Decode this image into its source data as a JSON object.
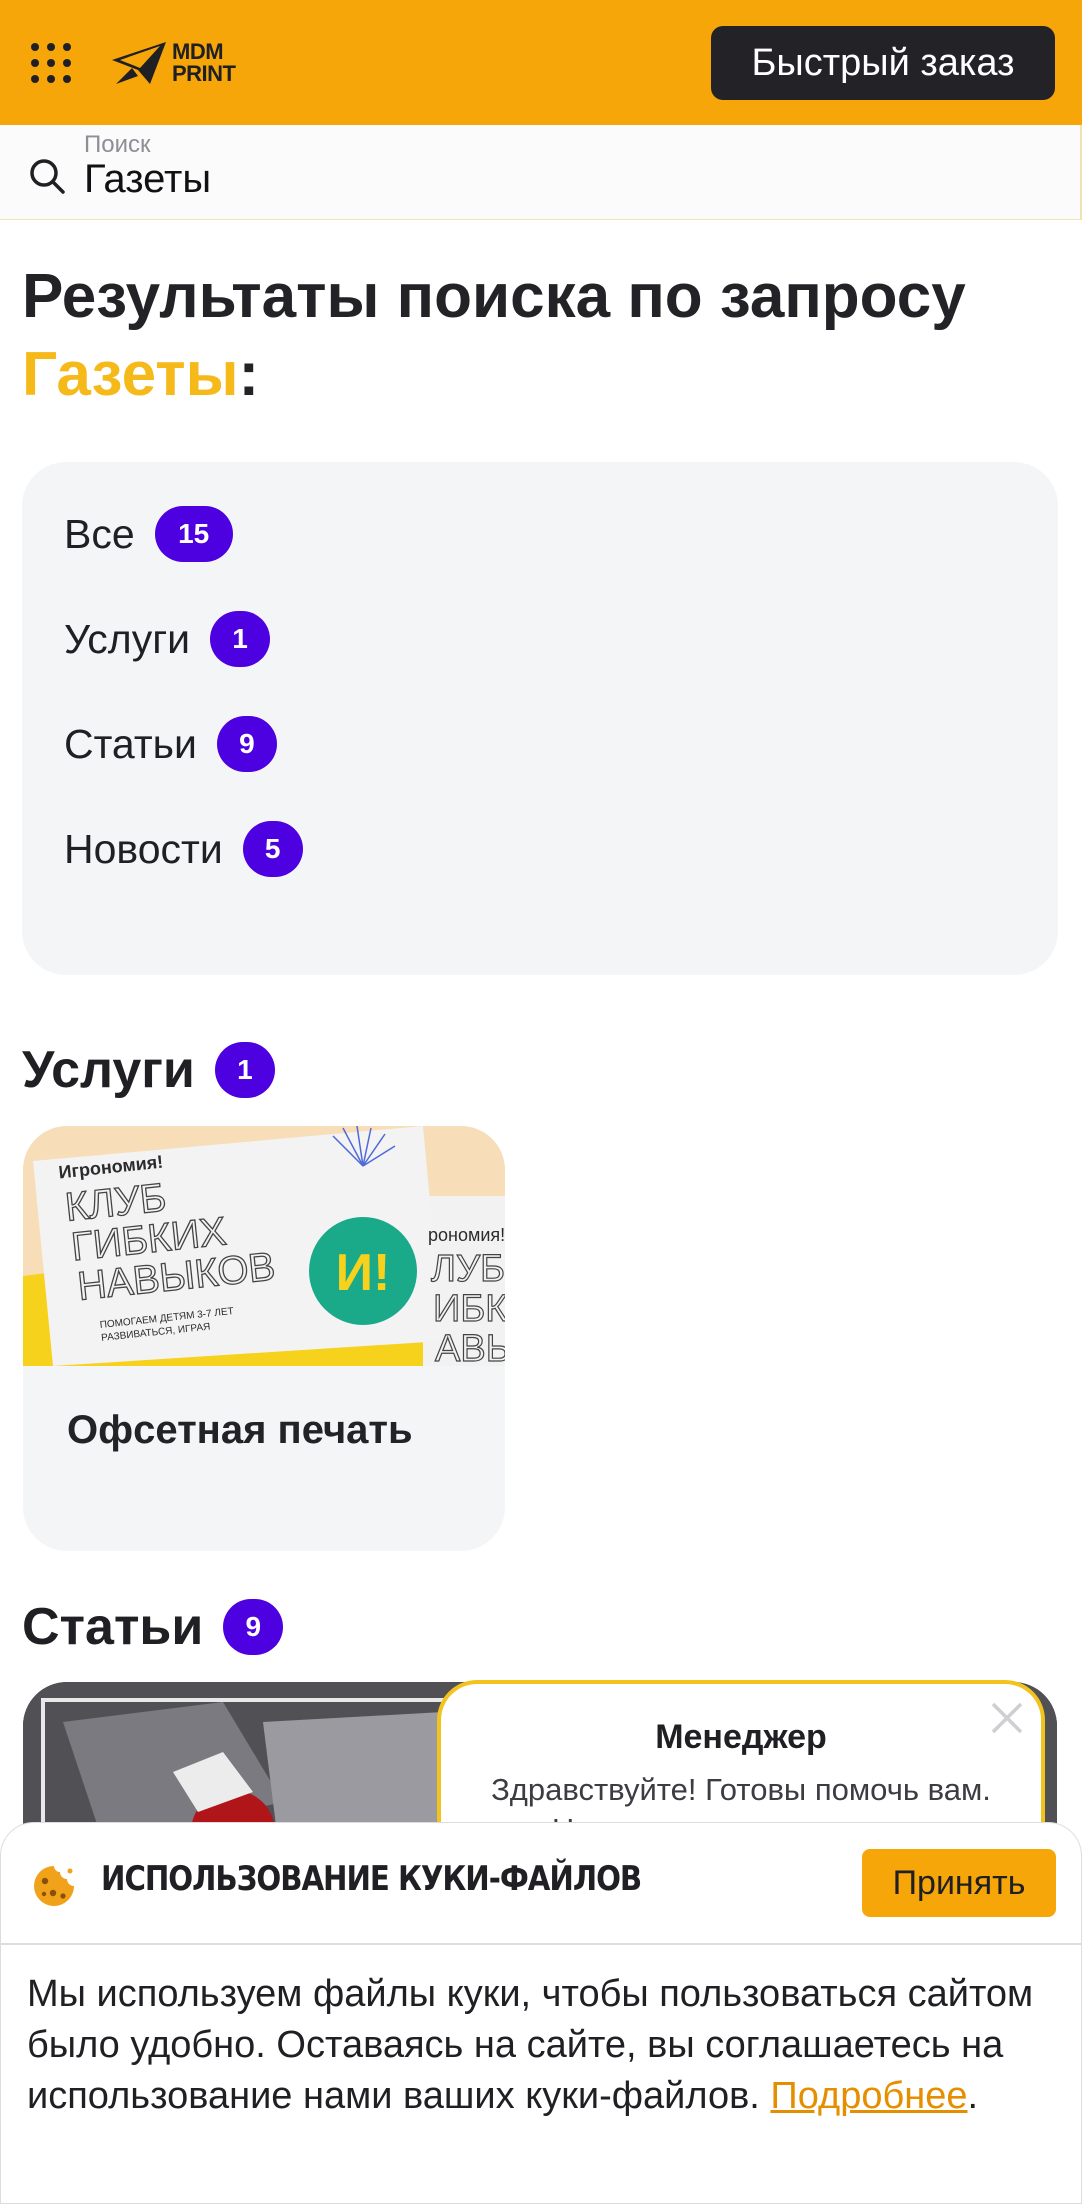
{
  "header": {
    "menu_icon": "grid-dots-icon",
    "logo_line1": "MDM",
    "logo_line2": "PRINT",
    "quick_order_label": "Быстрый заказ",
    "brand_color": "#f6a609"
  },
  "search": {
    "label": "Поиск",
    "value": "Газеты",
    "icon": "search-icon"
  },
  "results": {
    "title_prefix": "Результаты поиска по запросу",
    "query": "Газеты",
    "title_suffix": ":"
  },
  "filters": [
    {
      "label": "Все",
      "count": "15"
    },
    {
      "label": "Услуги",
      "count": "1"
    },
    {
      "label": "Статьи",
      "count": "9"
    },
    {
      "label": "Новости",
      "count": "5"
    }
  ],
  "services_section": {
    "title": "Услуги",
    "count": "1",
    "card": {
      "title": "Офсетная печать",
      "image_text": {
        "brand": "Игрономия!",
        "line1": "КЛУБ",
        "line2": "ГИБКИХ",
        "line3": "НАВЫКОВ",
        "tagline1": "ПОМОГАЕМ ДЕТЯМ 3-7 ЛЕТ",
        "tagline2": "РАЗВИВАТЬСЯ, ИГРАЯ",
        "logo": "И!",
        "side_brand": "рономия!",
        "side1": "ЛУБ",
        "side2": "ИБК",
        "side3": "АВЬ"
      }
    }
  },
  "articles_section": {
    "title": "Статьи",
    "count": "9"
  },
  "chat": {
    "title": "Менеджер",
    "message": "Здравствуйте! Готовы помочь вам. Напишите нам, если у вас"
  },
  "cookie": {
    "title": "ИСПОЛЬЗОВАНИЕ КУКИ-ФАЙЛОВ",
    "accept_label": "Принять",
    "text": "Мы используем файлы куки, чтобы пользоваться сайтом было удобно. Оставаясь на сайте, вы соглашаетесь на использование нами ваших куки-файлов. ",
    "link_label": "Подробнее",
    "text_end": "."
  },
  "colors": {
    "badge": "#4d00e0",
    "query_highlight": "#f6b91a",
    "chat_border": "#f2c21d",
    "link": "#e58f00"
  }
}
